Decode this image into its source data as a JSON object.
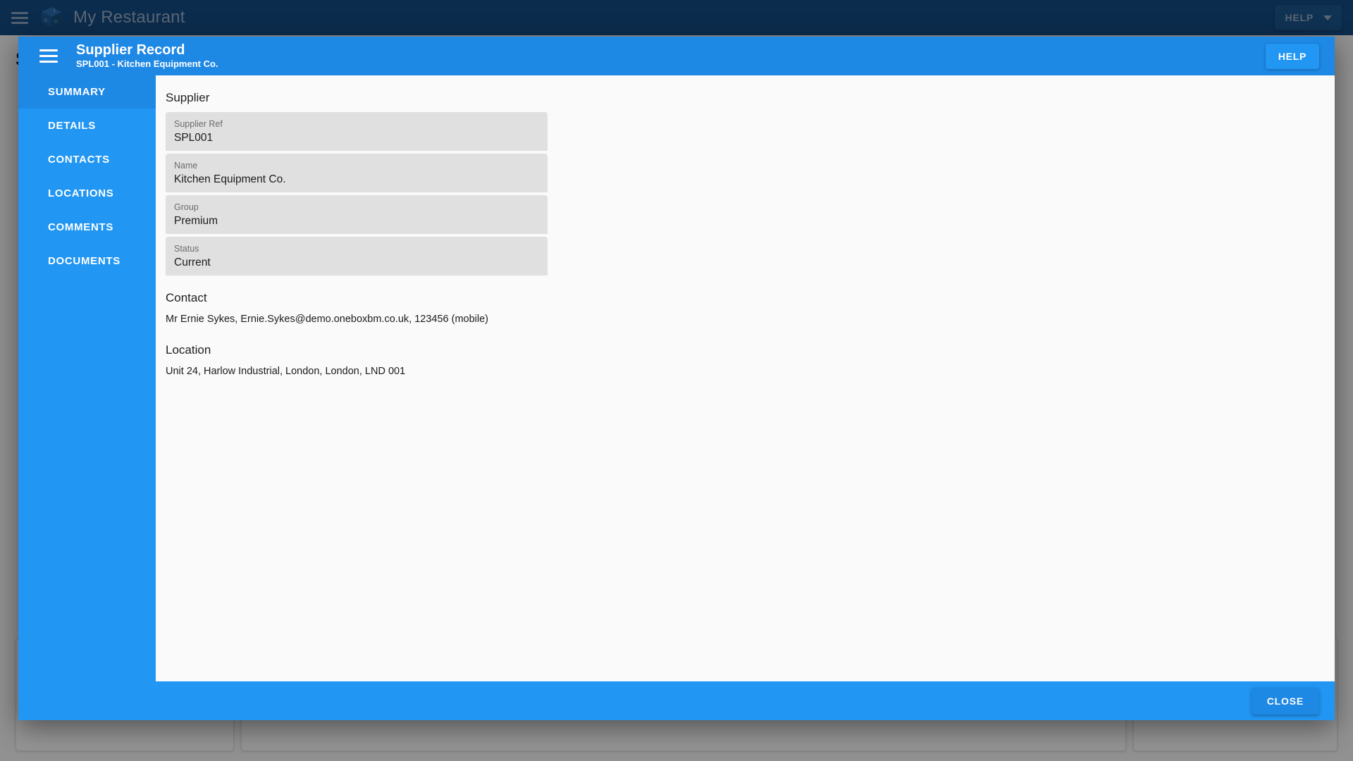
{
  "app": {
    "title": "My Restaurant",
    "menu_icon": "hamburger-menu-icon",
    "logo_icon": "obm-cube-logo-icon",
    "logo_faces": {
      "top": "1",
      "left": "B",
      "right": "M"
    },
    "help_label": "HELP",
    "help_caret_icon": "chevron-down-icon",
    "page_title": "Suppliers"
  },
  "dialog": {
    "menu_icon": "hamburger-menu-icon",
    "title": "Supplier Record",
    "subtitle": "SPL001 - Kitchen Equipment Co.",
    "help_label": "HELP",
    "close_label": "CLOSE",
    "sidebar": {
      "items": [
        {
          "label": "SUMMARY",
          "active": true
        },
        {
          "label": "DETAILS",
          "active": false
        },
        {
          "label": "CONTACTS",
          "active": false
        },
        {
          "label": "LOCATIONS",
          "active": false
        },
        {
          "label": "COMMENTS",
          "active": false
        },
        {
          "label": "DOCUMENTS",
          "active": false
        }
      ]
    },
    "content": {
      "supplier_heading": "Supplier",
      "fields": [
        {
          "label": "Supplier Ref",
          "value": "SPL001"
        },
        {
          "label": "Name",
          "value": "Kitchen Equipment Co."
        },
        {
          "label": "Group",
          "value": "Premium"
        },
        {
          "label": "Status",
          "value": "Current"
        }
      ],
      "contact_heading": "Contact",
      "contact_line": "Mr Ernie Sykes, Ernie.Sykes@demo.oneboxbm.co.uk, 123456 (mobile)",
      "location_heading": "Location",
      "location_line": "Unit 24, Harlow Industrial, London, London, LND 001"
    }
  },
  "colors": {
    "app_bar": "#154c86",
    "dialog_header": "#1e88e5",
    "sidebar": "#2196f3",
    "sidebar_active": "#1e88e5",
    "footer": "#2196f3",
    "field_bg": "#e0e0e0",
    "content_bg": "#fafafa",
    "scrim": "rgba(0,0,0,0.42)"
  }
}
